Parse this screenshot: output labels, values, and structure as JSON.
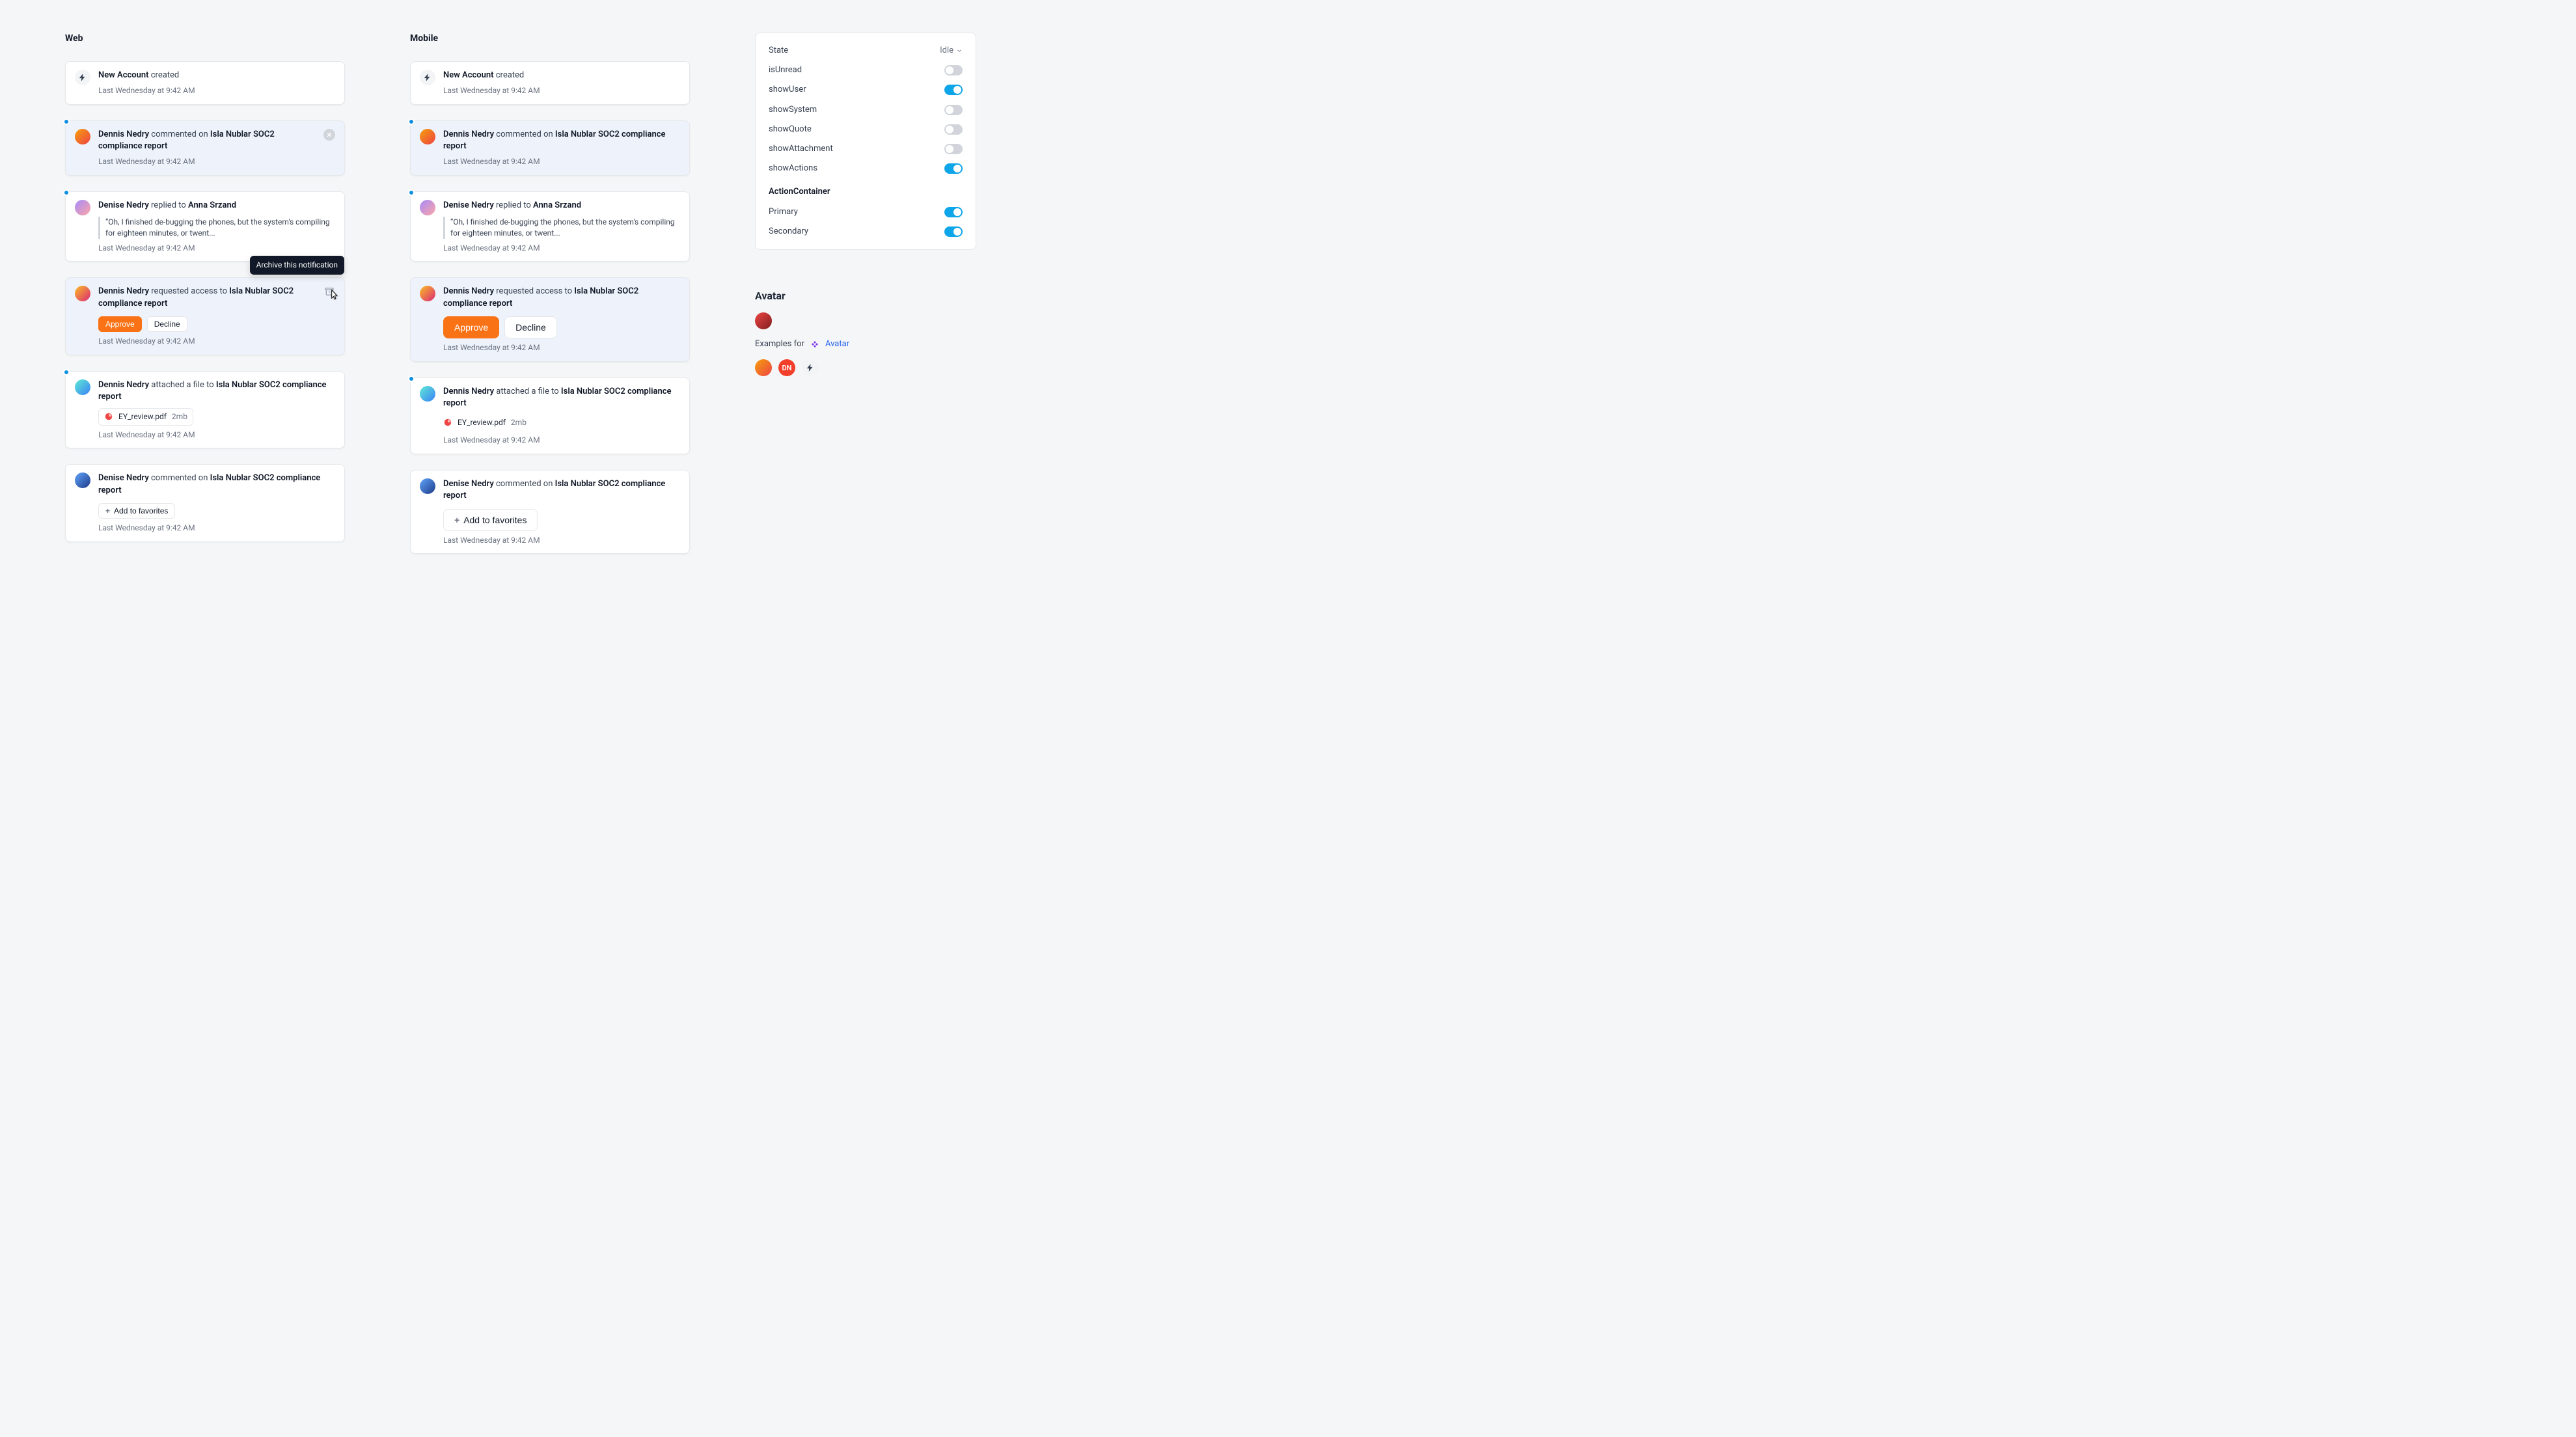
{
  "timestamps": {
    "default": "Last Wednesday at 9:42 AM"
  },
  "columns": {
    "web": "Web",
    "mobile": "Mobile"
  },
  "tooltip": {
    "archive": "Archive this notification"
  },
  "notifications": {
    "system_new_account": {
      "title_bold": "New Account",
      "title_tail": " created"
    },
    "comment": {
      "user": "Dennis Nedry",
      "verb": " commented on ",
      "target": "Isla Nublar SOC2 compliance report"
    },
    "reply": {
      "user": "Denise Nedry",
      "verb": " replied to ",
      "target": "Anna Srzand",
      "quote": "“Oh, I finished de-bugging the phones, but the system's compiling for eighteen minutes, or twent..."
    },
    "access": {
      "user": "Dennis Nedry",
      "verb": " requested access to ",
      "target": "Isla Nublar SOC2 compliance report",
      "approve": "Approve",
      "decline": "Decline"
    },
    "attachment": {
      "user": "Dennis Nedry",
      "verb": " attached a file to ",
      "target": "Isla Nublar SOC2 compliance report",
      "file": "EY_review.pdf",
      "size": "2mb"
    },
    "favorite": {
      "user": "Denise Nedry",
      "verb": " commented on ",
      "target": "Isla Nublar SOC2 compliance report",
      "button": "Add to favorites"
    }
  },
  "controls": {
    "state": {
      "label": "State",
      "value": "Idle"
    },
    "isUnread": {
      "label": "isUnread",
      "on": false
    },
    "showUser": {
      "label": "showUser",
      "on": true
    },
    "showSystem": {
      "label": "showSystem",
      "on": false
    },
    "showQuote": {
      "label": "showQuote",
      "on": false
    },
    "showAttachment": {
      "label": "showAttachment",
      "on": false
    },
    "showActions": {
      "label": "showActions",
      "on": true
    },
    "actionContainer": "ActionContainer",
    "primary": {
      "label": "Primary",
      "on": true
    },
    "secondary": {
      "label": "Secondary",
      "on": true
    }
  },
  "avatar": {
    "heading": "Avatar",
    "examples_prefix": "Examples for ",
    "link": "Avatar",
    "initials": "DN"
  }
}
